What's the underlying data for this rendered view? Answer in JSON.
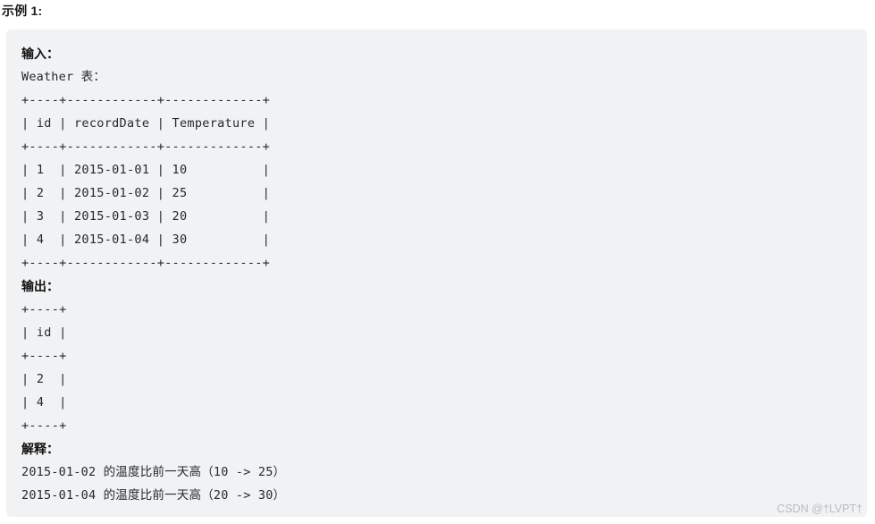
{
  "page": {
    "title": "示例 1:",
    "watermark": "CSDN @†LVPT†",
    "background_color": "#ffffff",
    "code_block_color": "#f1f2f4",
    "text_color": "#24292e",
    "watermark_color": "#b9bcc0"
  },
  "example": {
    "input_label": "输入：",
    "input_table_caption": "Weather 表：",
    "input_table": {
      "top_border": "+----+------------+-------------+",
      "header_row": "| id | recordDate | Temperature |",
      "header_separator": "+----+------------+-------------+",
      "rows": [
        "| 1  | 2015-01-01 | 10          |",
        "| 2  | 2015-01-02 | 25          |",
        "| 3  | 2015-01-03 | 20          |",
        "| 4  | 2015-01-04 | 30          |"
      ],
      "bottom_border": "+----+------------+-------------+",
      "columns": [
        "id",
        "recordDate",
        "Temperature"
      ],
      "data": [
        {
          "id": "1",
          "recordDate": "2015-01-01",
          "Temperature": "10"
        },
        {
          "id": "2",
          "recordDate": "2015-01-02",
          "Temperature": "25"
        },
        {
          "id": "3",
          "recordDate": "2015-01-03",
          "Temperature": "20"
        },
        {
          "id": "4",
          "recordDate": "2015-01-04",
          "Temperature": "30"
        }
      ]
    },
    "output_label": "输出：",
    "output_table": {
      "top_border": "+----+",
      "header_row": "| id |",
      "header_separator": "+----+",
      "rows": [
        "| 2  |",
        "| 4  |"
      ],
      "bottom_border": "+----+",
      "columns": [
        "id"
      ],
      "data": [
        {
          "id": "2"
        },
        {
          "id": "4"
        }
      ]
    },
    "explanation_label": "解释：",
    "explanation_lines": [
      "2015-01-02 的温度比前一天高（10 -> 25）",
      "2015-01-04 的温度比前一天高（20 -> 30）"
    ]
  }
}
